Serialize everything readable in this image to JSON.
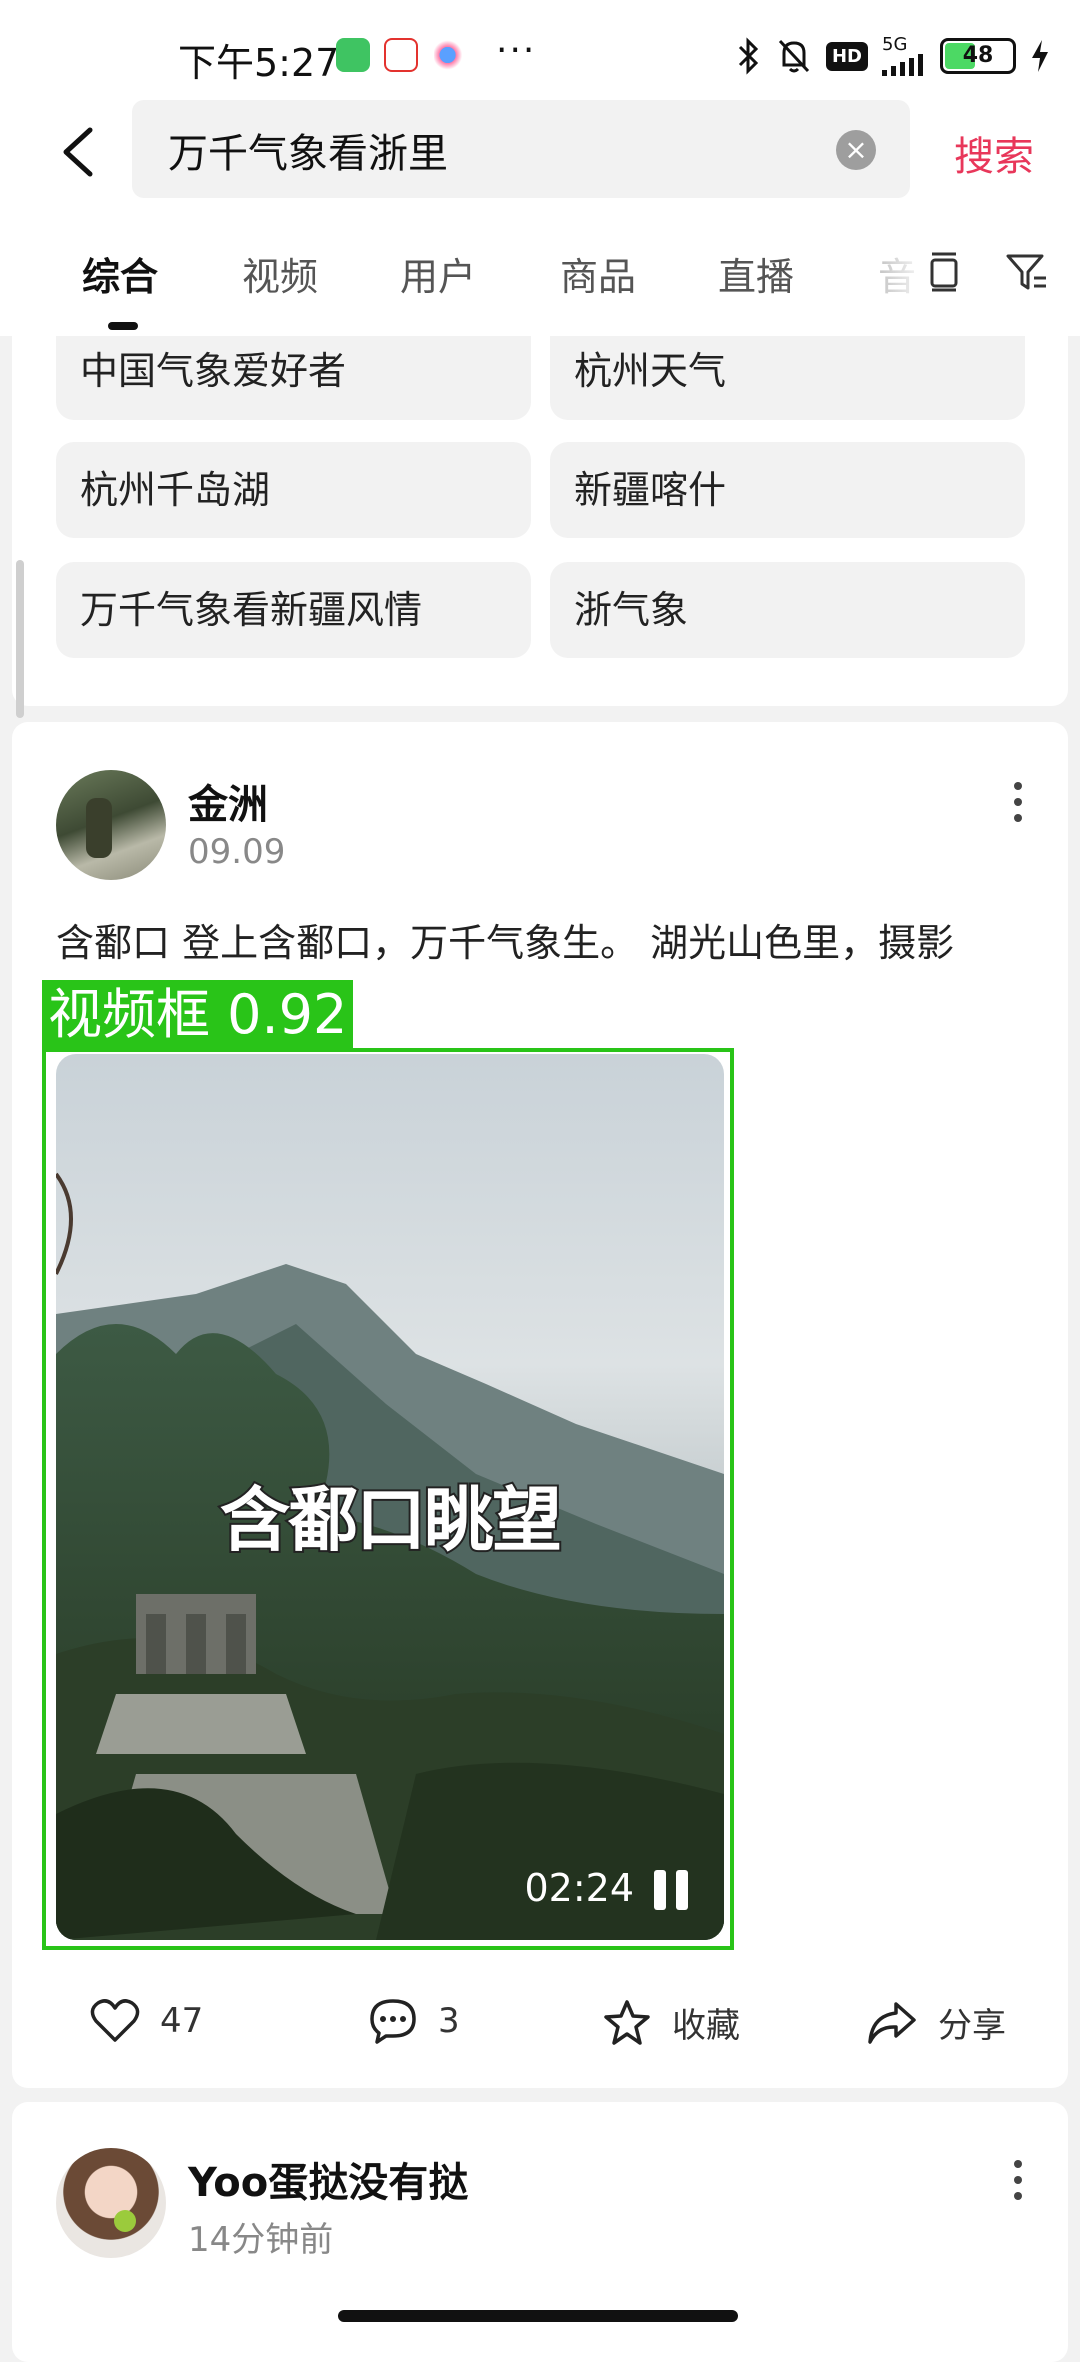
{
  "status_bar": {
    "time": "下午5:27",
    "app_icons": [
      "wechat-icon",
      "58-app-icon",
      "cloud-app-icon"
    ],
    "more": "···",
    "hd": "HD",
    "network": "5G",
    "battery": "48"
  },
  "search": {
    "query": "万千气象看浙里",
    "submit_label": "搜索"
  },
  "tabs": [
    {
      "label": "综合",
      "active": true
    },
    {
      "label": "视频"
    },
    {
      "label": "用户"
    },
    {
      "label": "商品"
    },
    {
      "label": "直播"
    },
    {
      "label": "音"
    }
  ],
  "suggestions": [
    "中国气象爱好者",
    "杭州天气",
    "杭州千岛湖",
    "新疆喀什",
    "万千气象看新疆风情",
    "浙气象"
  ],
  "post1": {
    "author": "金洲",
    "date": "09.09",
    "text": "含鄱口 登上含鄱口，万千气象生。 湖光山色里，摄影",
    "video_caption": "含鄱口眺望",
    "video_time": "02:24",
    "detection_label": "视频框 0.92",
    "likes": "47",
    "comments": "3",
    "favorite_label": "收藏",
    "share_label": "分享"
  },
  "post2": {
    "author": "Yoo蛋挞没有挞",
    "date": "14分钟前"
  },
  "colors": {
    "accent": "#e8375a",
    "detection": "#29c418",
    "background": "#f2f2f2"
  }
}
